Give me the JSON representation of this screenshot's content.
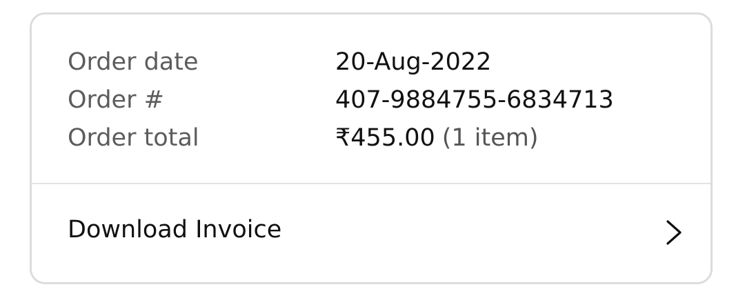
{
  "order": {
    "date_label": "Order date",
    "date_value": "20-Aug-2022",
    "number_label": "Order #",
    "number_value": "407-9884755-6834713",
    "total_label": "Order total",
    "total_currency": "₹",
    "total_amount": "455.00",
    "total_items": "(1 item)"
  },
  "actions": {
    "download_invoice_label": "Download Invoice",
    "chevron_icon": "chevron-right-icon"
  }
}
